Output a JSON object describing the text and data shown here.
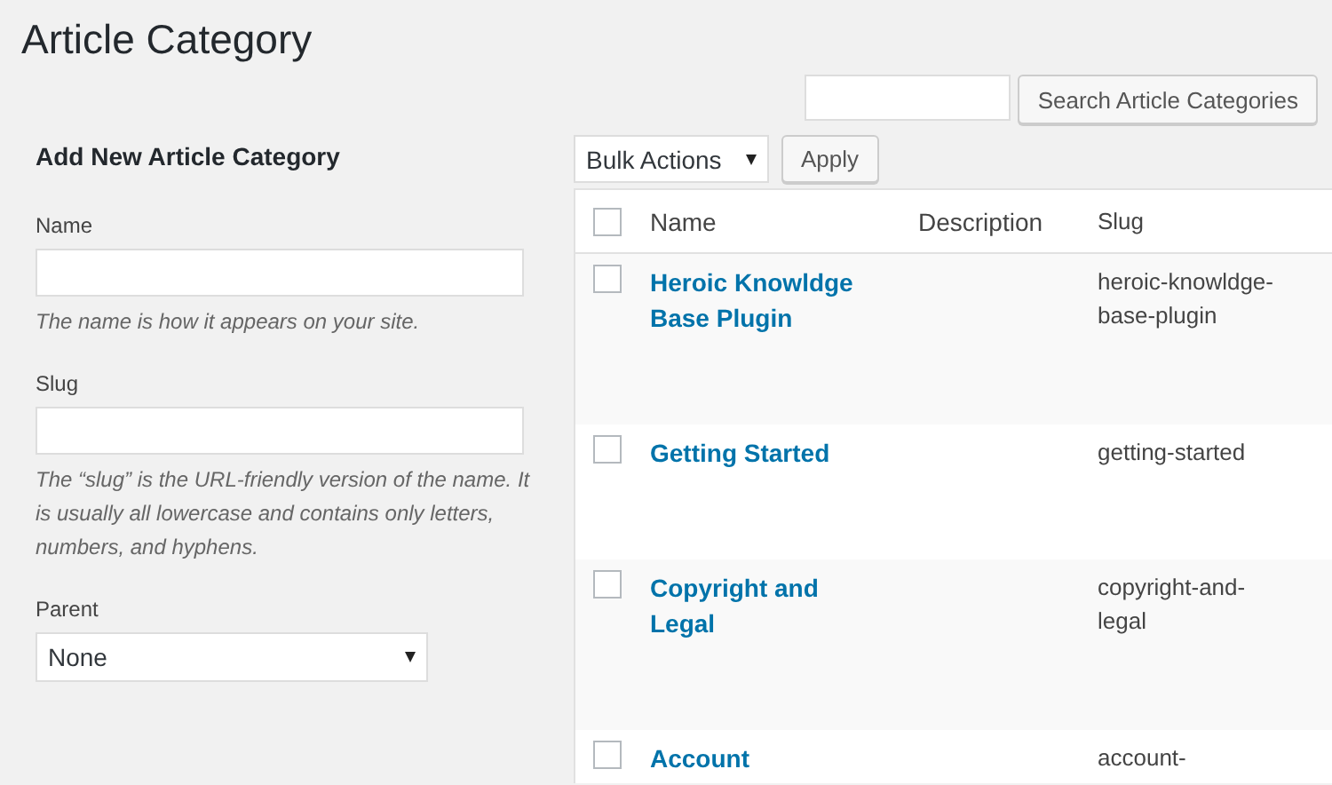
{
  "title": "Article Category",
  "search": {
    "button": "Search Article Categories"
  },
  "form": {
    "heading": "Add New Article Category",
    "fields": [
      {
        "kind": "text",
        "label": "Name",
        "help": "The name is how it appears on your site."
      },
      {
        "kind": "text",
        "label": "Slug",
        "help": "The “slug” is the URL-friendly version of the name. It is usually all lowercase and contains only letters, numbers, and hyphens."
      },
      {
        "kind": "select",
        "label": "Parent",
        "value": "None"
      }
    ]
  },
  "bulk": {
    "select": "Bulk Actions",
    "button": "Apply"
  },
  "table": {
    "header_checked": false,
    "columns": [
      "Name",
      "Description",
      "Slug"
    ],
    "rows": [
      {
        "name": "Heroic Knowldge Base Plugin",
        "slug": "heroic-knowldge-base-plugin",
        "checked": false
      },
      {
        "name": "Getting Started",
        "slug": "getting-started",
        "checked": false
      },
      {
        "name": "Copyright and Legal",
        "slug": "copyright-and-legal",
        "checked": false
      },
      {
        "name": "Account",
        "slug": "account-",
        "checked": false
      }
    ]
  }
}
